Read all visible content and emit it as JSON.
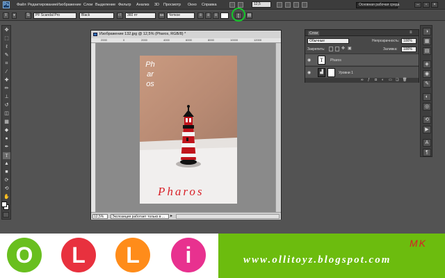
{
  "menubar": {
    "logo": "Ps",
    "items": [
      "Файл",
      "Редактирование",
      "Изображение",
      "Слои",
      "Выделение",
      "Фильтр",
      "Анализ",
      "3D",
      "Просмотр",
      "Окно",
      "Справка"
    ],
    "zoom": "12,5",
    "workspace": "Основная рабочая среда"
  },
  "options": {
    "font_family": "PF Scandal Pro",
    "font_style": "Black",
    "font_size": "360 пт",
    "antialias": "Четкое"
  },
  "toolbox": {
    "icons": [
      "move-icon",
      "marquee-icon",
      "lasso-icon",
      "quick-select-icon",
      "crop-icon",
      "eyedropper-icon",
      "healing-icon",
      "brush-icon",
      "stamp-icon",
      "history-brush-icon",
      "eraser-icon",
      "gradient-icon",
      "blur-icon",
      "dodge-icon",
      "pen-icon",
      "type-icon",
      "path-select-icon",
      "shape-icon",
      "3d-rotate-icon",
      "3d-orbit-icon",
      "hand-icon",
      "zoom-icon"
    ]
  },
  "document": {
    "title": "Изображение 132.jpg @ 12,5% (Pharos, RGB/8) *",
    "ruler_marks": [
      "2000",
      "0",
      "2000",
      "4000",
      "6000",
      "8000",
      "10000",
      "12000"
    ],
    "photo_vertical_text": "Pharos",
    "photo_bottom_text": "Pharos",
    "zoom": "12,5%",
    "status": "Экспозиция работает только в ..."
  },
  "layers": {
    "tab": "Слои",
    "blend_mode": "Обычные",
    "opacity_label": "Непрозрачность:",
    "opacity": "100%",
    "lock_label": "Закрепить:",
    "fill_label": "Заливка:",
    "fill": "100%",
    "rows": [
      {
        "name": "Pharos",
        "thumb": "T"
      },
      {
        "name": "Уровни 1",
        "thumb": ""
      }
    ]
  },
  "banner": {
    "letters": [
      "O",
      "L",
      "L",
      "i"
    ],
    "letter_colors": [
      "#69bf1f",
      "#e8313e",
      "#ff8c1a",
      "#e8318f"
    ],
    "mk": "MK",
    "url": "www.ollitoyz.blogspot.com"
  },
  "colors": {
    "accent_green": "#14c82a",
    "banner_green": "#6cbc0e",
    "text_red": "#d81f26"
  }
}
